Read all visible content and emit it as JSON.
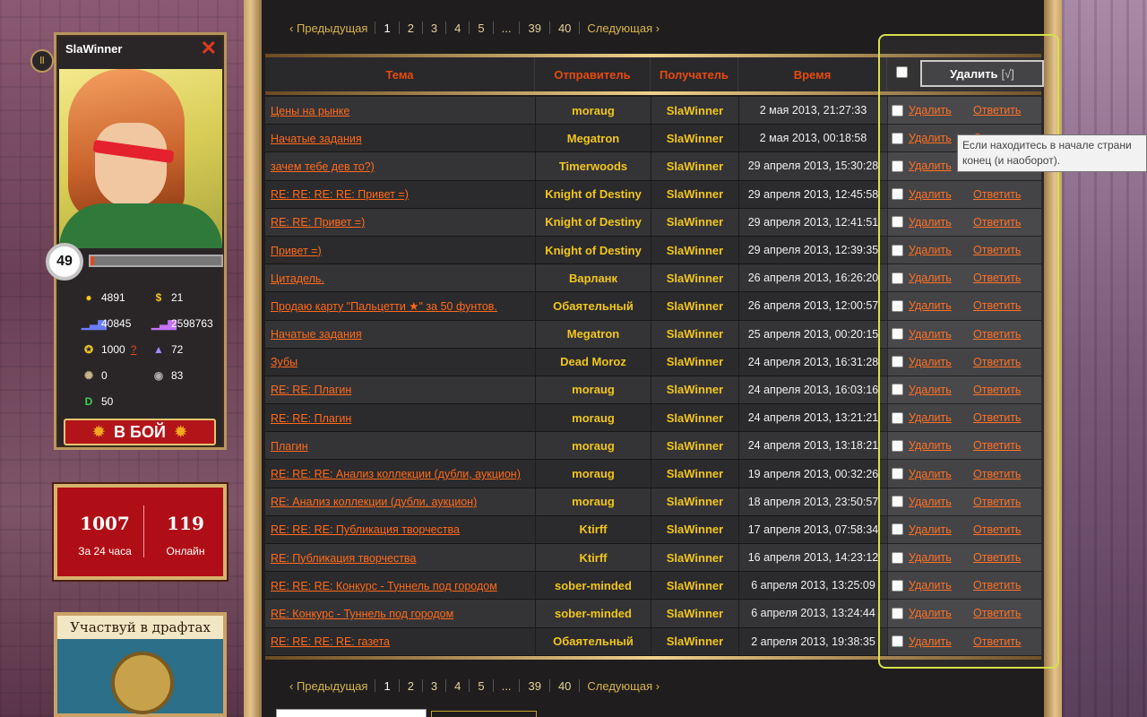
{
  "player": {
    "name": "SlaWinner",
    "level": "49",
    "xp_fraction": 0.03,
    "stats": [
      {
        "icon": "gold-coin-icon",
        "value": "4891"
      },
      {
        "icon": "dollar-icon",
        "value": "21"
      },
      {
        "icon": "rating-bars-icon",
        "value": "40845"
      },
      {
        "icon": "rating-bars-purple-icon",
        "value": "2598763"
      },
      {
        "icon": "badge-icon",
        "value": "1000",
        "extra": "?"
      },
      {
        "icon": "triangle-icon",
        "value": "72"
      },
      {
        "icon": "gear-coin-icon",
        "value": "0"
      },
      {
        "icon": "round-token-icon",
        "value": "83"
      },
      {
        "icon": "d-token-icon",
        "value": "50"
      }
    ],
    "fight_label": "В БОЙ"
  },
  "online": {
    "day_count": "1007",
    "day_label": "За 24 часа",
    "online_count": "119",
    "online_label": "Онлайн"
  },
  "draft": {
    "title": "Участвуй в драфтах"
  },
  "pager": {
    "prev": "Предыдущая",
    "next": "Следующая",
    "pages": [
      "1",
      "2",
      "3",
      "4",
      "5",
      "...",
      "39",
      "40"
    ]
  },
  "table": {
    "headers": {
      "subject": "Тема",
      "sender": "Отправитель",
      "recipient": "Получатель",
      "time": "Время"
    },
    "delete_selected": "Удалить",
    "delete_selected_mark": "[√]",
    "delete_label": "Удалить",
    "reply_label": "Ответить",
    "rows": [
      {
        "subject": "Цены на рынке",
        "sender": "moraug",
        "recipient": "SlaWinner",
        "time": "2 мая 2013, 21:27:33"
      },
      {
        "subject": "Начатые задания",
        "sender": "Megatron",
        "recipient": "SlaWinner",
        "time": "2 мая 2013, 00:18:58"
      },
      {
        "subject": "зачем тебе дев то?)",
        "sender": "Timerwoods",
        "recipient": "SlaWinner",
        "time": "29 апреля 2013, 15:30:28"
      },
      {
        "subject": "RE: RE: RE: RE: Привет =)",
        "sender": "Knight of Destiny",
        "recipient": "SlaWinner",
        "time": "29 апреля 2013, 12:45:58"
      },
      {
        "subject": "RE: RE: Привет =)",
        "sender": "Knight of Destiny",
        "recipient": "SlaWinner",
        "time": "29 апреля 2013, 12:41:51"
      },
      {
        "subject": "Привет =)",
        "sender": "Knight of Destiny",
        "recipient": "SlaWinner",
        "time": "29 апреля 2013, 12:39:35"
      },
      {
        "subject": "Цитадель.",
        "sender": "Варланк",
        "recipient": "SlaWinner",
        "time": "26 апреля 2013, 16:26:20"
      },
      {
        "subject": "Продаю карту \"Пальцетти ★\" за 50 фунтов.",
        "sender": "Обаятельный",
        "recipient": "SlaWinner",
        "time": "26 апреля 2013, 12:00:57"
      },
      {
        "subject": "Начатые задания",
        "sender": "Megatron",
        "recipient": "SlaWinner",
        "time": "25 апреля 2013, 00:20:15"
      },
      {
        "subject": "Зубы",
        "sender": "Dead Moroz",
        "recipient": "SlaWinner",
        "time": "24 апреля 2013, 16:31:28"
      },
      {
        "subject": "RE: RE: Плагин",
        "sender": "moraug",
        "recipient": "SlaWinner",
        "time": "24 апреля 2013, 16:03:16"
      },
      {
        "subject": "RE: RE: Плагин",
        "sender": "moraug",
        "recipient": "SlaWinner",
        "time": "24 апреля 2013, 13:21:21"
      },
      {
        "subject": "Плагин",
        "sender": "moraug",
        "recipient": "SlaWinner",
        "time": "24 апреля 2013, 13:18:21"
      },
      {
        "subject": "RE: RE: RE: Анализ коллекции (дубли, аукцион)",
        "sender": "moraug",
        "recipient": "SlaWinner",
        "time": "19 апреля 2013, 00:32:26"
      },
      {
        "subject": "RE: Анализ коллекции (дубли, аукцион)",
        "sender": "moraug",
        "recipient": "SlaWinner",
        "time": "18 апреля 2013, 23:50:57"
      },
      {
        "subject": "RE: RE: RE: Публикация творчества",
        "sender": "Ktirff",
        "recipient": "SlaWinner",
        "time": "17 апреля 2013, 07:58:34"
      },
      {
        "subject": "RE: Публикация творчества",
        "sender": "Ktirff",
        "recipient": "SlaWinner",
        "time": "16 апреля 2013, 14:23:12"
      },
      {
        "subject": "RE: RE: RE: Конкурс - Туннель под городом",
        "sender": "sober-minded",
        "recipient": "SlaWinner",
        "time": "6 апреля 2013, 13:25:09"
      },
      {
        "subject": "RE: Конкурс - Туннель под городом",
        "sender": "sober-minded",
        "recipient": "SlaWinner",
        "time": "6 апреля 2013, 13:24:44"
      },
      {
        "subject": "RE: RE: RE: RE: газета",
        "sender": "Обаятельный",
        "recipient": "SlaWinner",
        "time": "2 апреля 2013, 19:38:35"
      }
    ]
  },
  "tooltip": {
    "line1": "Если находитесь в начале страни",
    "line2": "конец (и наоборот)."
  },
  "colors": {
    "accent": "#ff6a1a",
    "name": "#f2c61a",
    "highlight": "#d6e04a"
  }
}
